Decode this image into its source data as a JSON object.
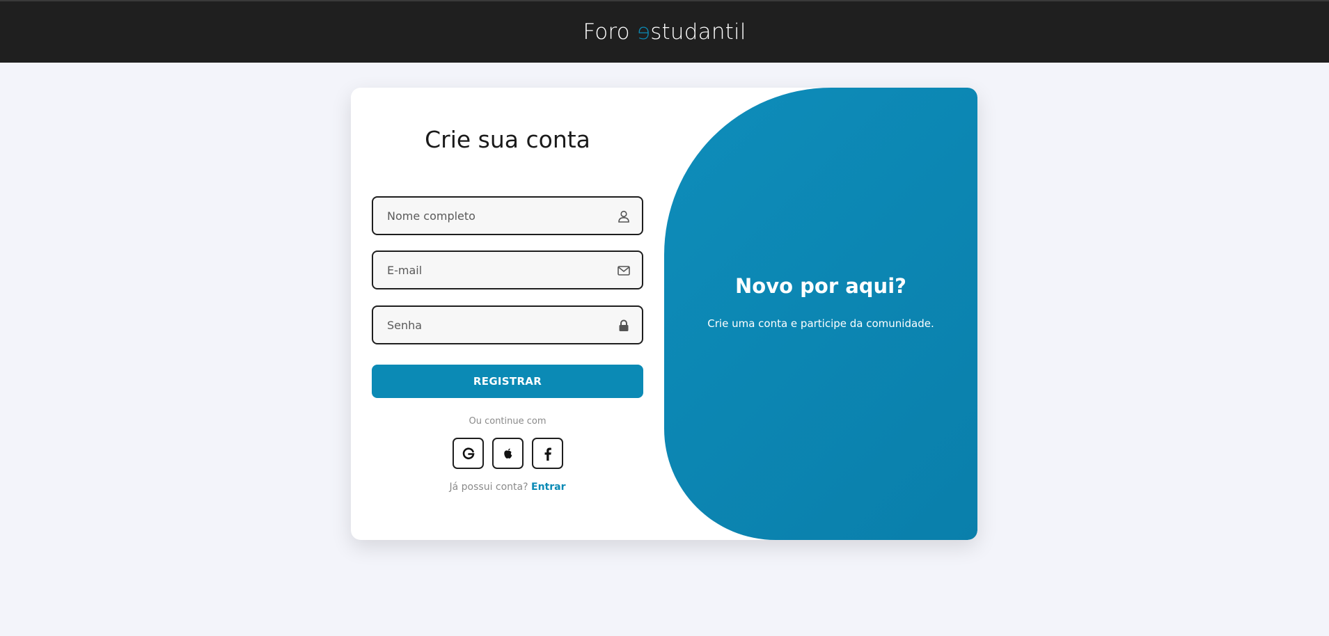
{
  "header": {
    "brand_part1": "Foro ",
    "brand_e": "e",
    "brand_part2": "studantil"
  },
  "form": {
    "title": "Crie sua conta",
    "fields": [
      {
        "placeholder": "Nome completo",
        "value": "",
        "icon": "user-icon"
      },
      {
        "placeholder": "E-mail",
        "value": "",
        "icon": "mail-icon"
      },
      {
        "placeholder": "Senha",
        "value": "",
        "icon": "lock-icon"
      }
    ],
    "register_label": "REGISTRAR",
    "or_continue": "Ou continue com",
    "socials": [
      "google-icon",
      "apple-icon",
      "facebook-icon"
    ],
    "has_account": "Já possui conta?",
    "login_link": "Entrar"
  },
  "panel": {
    "heading": "Novo por aqui?",
    "text": "Crie uma conta e participe da comunidade."
  },
  "colors": {
    "accent": "#0b8ab5",
    "header_bg": "#1f1f1f",
    "page_bg": "#f3f4fa"
  }
}
